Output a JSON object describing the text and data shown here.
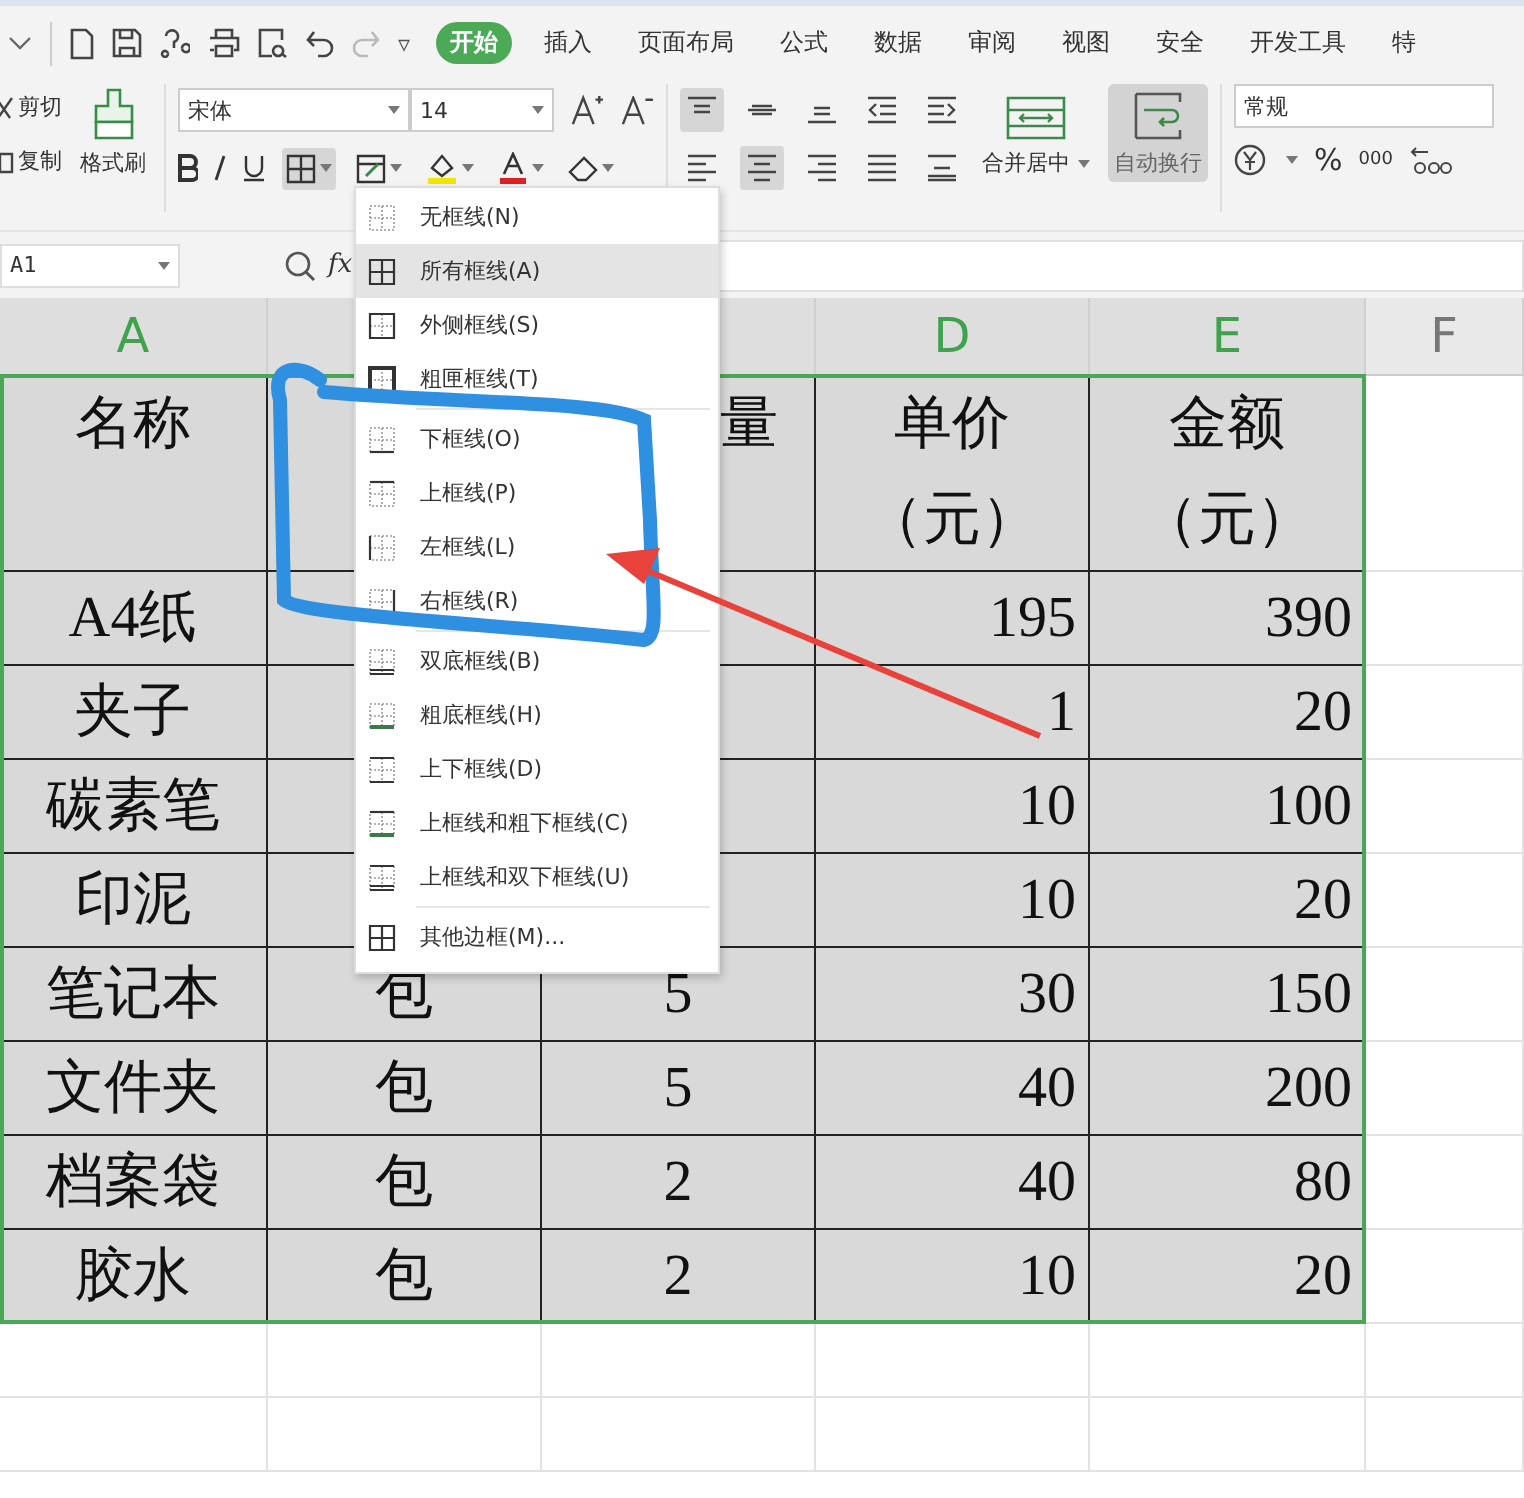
{
  "quick_access": {
    "more": "▿"
  },
  "tabs": [
    {
      "label": "开始",
      "selected": true
    },
    {
      "label": "插入",
      "selected": false
    },
    {
      "label": "页面布局",
      "selected": false
    },
    {
      "label": "公式",
      "selected": false
    },
    {
      "label": "数据",
      "selected": false
    },
    {
      "label": "审阅",
      "selected": false
    },
    {
      "label": "视图",
      "selected": false
    },
    {
      "label": "安全",
      "selected": false
    },
    {
      "label": "开发工具",
      "selected": false
    },
    {
      "label": "特",
      "selected": false
    }
  ],
  "ribbon": {
    "cut": "剪切",
    "copy": "复制",
    "format_painter": "格式刷",
    "font": "宋体",
    "font_size": "14",
    "merge_center": "合并居中",
    "wrap_text": "自动换行",
    "number_format": "常规",
    "percent": "%",
    "thousands": "000",
    "border_active": true,
    "wrap_active": true
  },
  "formula_bar": {
    "name_box": "A1",
    "fx": "fx"
  },
  "columns": [
    {
      "label": "A",
      "selected": true
    },
    {
      "label": "D",
      "selected": true
    },
    {
      "label": "E",
      "selected": true
    },
    {
      "label": "F",
      "selected": false
    }
  ],
  "rows": [
    {
      "cells": [
        "名称",
        "",
        "量",
        "单价（元）",
        "金额（元）"
      ]
    },
    {
      "cells": [
        "A4纸",
        "",
        "",
        "195",
        "390"
      ]
    },
    {
      "cells": [
        "夹子",
        "",
        "",
        "1",
        "20"
      ]
    },
    {
      "cells": [
        "碳素笔",
        "",
        "",
        "10",
        "100"
      ]
    },
    {
      "cells": [
        "印泥",
        "",
        "",
        "10",
        "20"
      ]
    },
    {
      "cells": [
        "笔记本",
        "包",
        "5",
        "30",
        "150"
      ]
    },
    {
      "cells": [
        "文件夹",
        "包",
        "5",
        "40",
        "200"
      ]
    },
    {
      "cells": [
        "档案袋",
        "包",
        "2",
        "40",
        "80"
      ]
    },
    {
      "cells": [
        "胶水",
        "包",
        "2",
        "10",
        "20"
      ]
    }
  ],
  "border_menu": {
    "items": [
      {
        "label": "无框线(N)",
        "kind": "none",
        "selected": false
      },
      {
        "label": "所有框线(A)",
        "kind": "all",
        "selected": true
      },
      {
        "label": "外侧框线(S)",
        "kind": "outside",
        "selected": false
      },
      {
        "label": "粗匣框线(T)",
        "kind": "thick",
        "selected": false,
        "separator_after": true
      },
      {
        "label": "下框线(O)",
        "kind": "bottom",
        "selected": false
      },
      {
        "label": "上框线(P)",
        "kind": "top",
        "selected": false
      },
      {
        "label": "左框线(L)",
        "kind": "left",
        "selected": false
      },
      {
        "label": "右框线(R)",
        "kind": "right",
        "selected": false,
        "separator_after": true
      },
      {
        "label": "双底框线(B)",
        "kind": "double",
        "selected": false
      },
      {
        "label": "粗底框线(H)",
        "kind": "thickbottom",
        "selected": false
      },
      {
        "label": "上下框线(D)",
        "kind": "topbottom",
        "selected": false
      },
      {
        "label": "上框线和粗下框线(C)",
        "kind": "topthick",
        "selected": false
      },
      {
        "label": "上框线和双下框线(U)",
        "kind": "topdouble",
        "selected": false,
        "separator_after": true
      },
      {
        "label": "其他边框(M)...",
        "kind": "all",
        "selected": false
      }
    ]
  }
}
